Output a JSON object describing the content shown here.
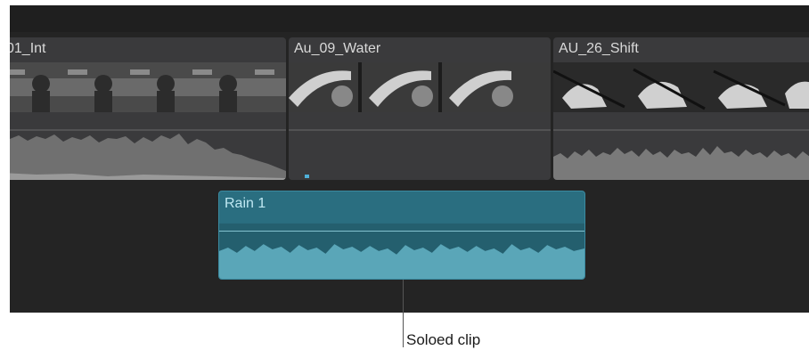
{
  "timeline": {
    "clips": [
      {
        "title": "01_Int"
      },
      {
        "title": "Au_09_Water"
      },
      {
        "title": "AU_26_Shift"
      }
    ],
    "soloed_audio_clip": {
      "title": "Rain 1"
    }
  },
  "callout": {
    "label": "Soloed clip"
  },
  "colors": {
    "timeline_bg": "#242424",
    "clip_bg": "#3a3a3c",
    "audio_clip_bg": "#2a6e80",
    "audio_waveform": "#5aa6b8",
    "accent_marker": "#4fb0d8"
  }
}
